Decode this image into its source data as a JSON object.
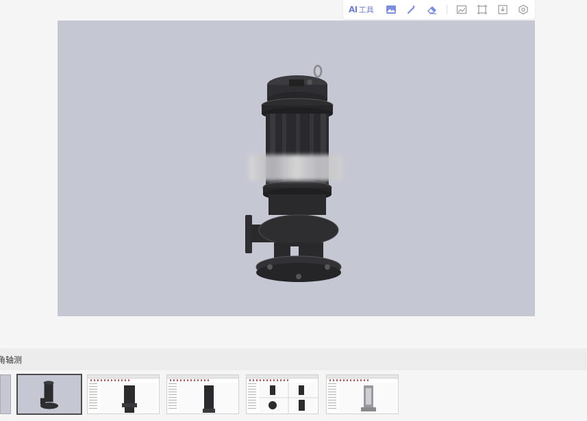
{
  "toolbar": {
    "ai_mark": "AI",
    "ai_label": "工具",
    "icons": [
      "image-icon",
      "magic-wand-icon",
      "eraser-icon",
      "image-edit-icon",
      "crop-icon",
      "download-icon",
      "settings-icon"
    ],
    "accent_color": "#6f7fd4"
  },
  "viewer": {
    "background_color": "#c5c8d3",
    "model": "submersible-pump"
  },
  "view_strip": {
    "label": "角轴测"
  },
  "thumbnails": {
    "count": 6,
    "active_index": 1,
    "items": [
      "thumbnail-partial",
      "thumbnail-isometric",
      "thumbnail-front",
      "thumbnail-side",
      "thumbnail-multiview",
      "thumbnail-section"
    ]
  }
}
